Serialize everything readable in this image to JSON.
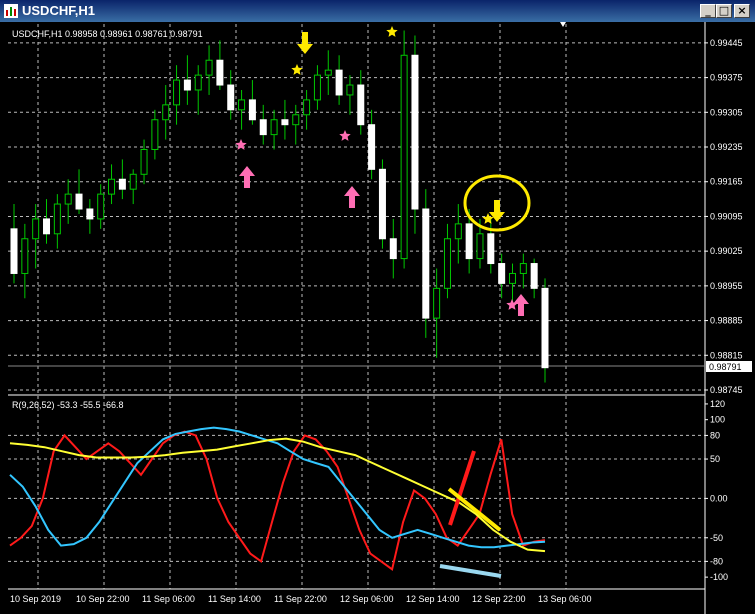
{
  "window": {
    "title": "USDCHF,H1"
  },
  "price_header": "USDCHF,H1  0.98958 0.98961 0.98761 0.98791",
  "indicator_header": "R(9,26,52) -53.3 -55.5 -66.8",
  "current_price_label": "0.98791",
  "price_ticks": [
    "0.99445",
    "0.99375",
    "0.99305",
    "0.99235",
    "0.99165",
    "0.99095",
    "0.99025",
    "0.98955",
    "0.98885",
    "0.98815",
    "0.98745"
  ],
  "indicator_ticks": [
    "120",
    "100",
    "80",
    "50",
    "0.00",
    "-50",
    "-80",
    "-100"
  ],
  "time_ticks": [
    "10 Sep 2019",
    "10 Sep 22:00",
    "11 Sep 06:00",
    "11 Sep 14:00",
    "11 Sep 22:00",
    "12 Sep 06:00",
    "12 Sep 14:00",
    "12 Sep 22:00",
    "13 Sep 06:00"
  ],
  "chart_data": [
    {
      "type": "candlestick",
      "symbol": "USDCHF",
      "timeframe": "H1",
      "ylim": [
        0.98745,
        0.99475
      ],
      "ohlc": [
        [
          0.9907,
          0.9912,
          0.9896,
          0.9898
        ],
        [
          0.9898,
          0.9908,
          0.9893,
          0.9905
        ],
        [
          0.9905,
          0.9912,
          0.9899,
          0.9909
        ],
        [
          0.9909,
          0.9913,
          0.9904,
          0.9906
        ],
        [
          0.9906,
          0.9914,
          0.9903,
          0.9912
        ],
        [
          0.9912,
          0.9917,
          0.9908,
          0.9914
        ],
        [
          0.9914,
          0.9919,
          0.991,
          0.9911
        ],
        [
          0.9911,
          0.9913,
          0.9906,
          0.9909
        ],
        [
          0.9909,
          0.9916,
          0.9907,
          0.9914
        ],
        [
          0.9914,
          0.992,
          0.9912,
          0.9917
        ],
        [
          0.9917,
          0.9921,
          0.9913,
          0.9915
        ],
        [
          0.9915,
          0.9919,
          0.9912,
          0.9918
        ],
        [
          0.9918,
          0.9925,
          0.9916,
          0.9923
        ],
        [
          0.9923,
          0.9931,
          0.9921,
          0.9929
        ],
        [
          0.9929,
          0.9936,
          0.9925,
          0.9932
        ],
        [
          0.9932,
          0.994,
          0.9928,
          0.9937
        ],
        [
          0.9937,
          0.9942,
          0.9932,
          0.9935
        ],
        [
          0.9935,
          0.994,
          0.993,
          0.9938
        ],
        [
          0.9938,
          0.9944,
          0.9934,
          0.9941
        ],
        [
          0.9941,
          0.9945,
          0.9935,
          0.9936
        ],
        [
          0.9936,
          0.9939,
          0.9929,
          0.9931
        ],
        [
          0.9931,
          0.9935,
          0.9927,
          0.9933
        ],
        [
          0.9933,
          0.9937,
          0.9928,
          0.9929
        ],
        [
          0.9929,
          0.9932,
          0.9924,
          0.9926
        ],
        [
          0.9926,
          0.9931,
          0.9923,
          0.9929
        ],
        [
          0.9929,
          0.9933,
          0.9925,
          0.9928
        ],
        [
          0.9928,
          0.9932,
          0.9924,
          0.993
        ],
        [
          0.993,
          0.9935,
          0.9927,
          0.9933
        ],
        [
          0.9933,
          0.994,
          0.9931,
          0.9938
        ],
        [
          0.9938,
          0.9943,
          0.9934,
          0.9939
        ],
        [
          0.9939,
          0.9942,
          0.9932,
          0.9934
        ],
        [
          0.9934,
          0.9938,
          0.993,
          0.9936
        ],
        [
          0.9936,
          0.9939,
          0.9926,
          0.9928
        ],
        [
          0.9928,
          0.9931,
          0.9917,
          0.9919
        ],
        [
          0.9919,
          0.9921,
          0.9903,
          0.9905
        ],
        [
          0.9905,
          0.9909,
          0.9897,
          0.9901
        ],
        [
          0.9901,
          0.9947,
          0.9899,
          0.9942
        ],
        [
          0.9942,
          0.9946,
          0.9906,
          0.9911
        ],
        [
          0.9911,
          0.9915,
          0.9885,
          0.9889
        ],
        [
          0.9889,
          0.9899,
          0.9881,
          0.9895
        ],
        [
          0.9895,
          0.9908,
          0.9893,
          0.9905
        ],
        [
          0.9905,
          0.9912,
          0.99,
          0.9908
        ],
        [
          0.9908,
          0.9911,
          0.9898,
          0.9901
        ],
        [
          0.9901,
          0.9909,
          0.9899,
          0.9906
        ],
        [
          0.9906,
          0.9909,
          0.9898,
          0.99
        ],
        [
          0.99,
          0.9902,
          0.9893,
          0.9896
        ],
        [
          0.9896,
          0.99,
          0.9891,
          0.9898
        ],
        [
          0.9898,
          0.9902,
          0.9895,
          0.99
        ],
        [
          0.99,
          0.9901,
          0.9893,
          0.9895
        ],
        [
          0.9895,
          0.9897,
          0.9876,
          0.9879
        ]
      ],
      "annotations": [
        "yellow-star-markers",
        "pink-star-markers",
        "yellow-down-arrows",
        "pink-up-arrows",
        "yellow-highlight-circle"
      ]
    },
    {
      "type": "line",
      "title": "R(9,26,52)",
      "ylim": [
        -110,
        125
      ],
      "levels": [
        80,
        50,
        0,
        -50,
        -80
      ],
      "series": [
        {
          "name": "9",
          "color": "#ff1a1a",
          "values": [
            -60,
            -50,
            -35,
            0,
            60,
            80,
            65,
            50,
            60,
            70,
            60,
            45,
            30,
            50,
            70,
            80,
            85,
            80,
            50,
            0,
            -30,
            -50,
            -70,
            -80,
            -30,
            20,
            60,
            80,
            75,
            60,
            40,
            0,
            -40,
            -70,
            -80,
            -90,
            -30,
            10,
            0,
            -20,
            -50,
            -60,
            -40,
            -20,
            30,
            75,
            -20,
            -60,
            -55,
            -53
          ]
        },
        {
          "name": "26",
          "color": "#33c6ff",
          "values": [
            30,
            15,
            -10,
            -40,
            -60,
            -58,
            -50,
            -30,
            -5,
            20,
            45,
            60,
            75,
            82,
            85,
            88,
            90,
            88,
            85,
            80,
            75,
            70,
            60,
            50,
            45,
            40,
            20,
            0,
            -20,
            -40,
            -50,
            -45,
            -40,
            -45,
            -50,
            -55,
            -60,
            -62,
            -62,
            -60,
            -58,
            -56,
            -55
          ]
        },
        {
          "name": "52",
          "color": "#ffff33",
          "values": [
            70,
            68,
            65,
            60,
            55,
            52,
            52,
            52,
            53,
            55,
            58,
            60,
            62,
            66,
            70,
            74,
            76,
            72,
            65,
            60,
            55,
            45,
            35,
            25,
            15,
            5,
            -5,
            -20,
            -40,
            -55,
            -65,
            -67
          ]
        }
      ]
    }
  ]
}
